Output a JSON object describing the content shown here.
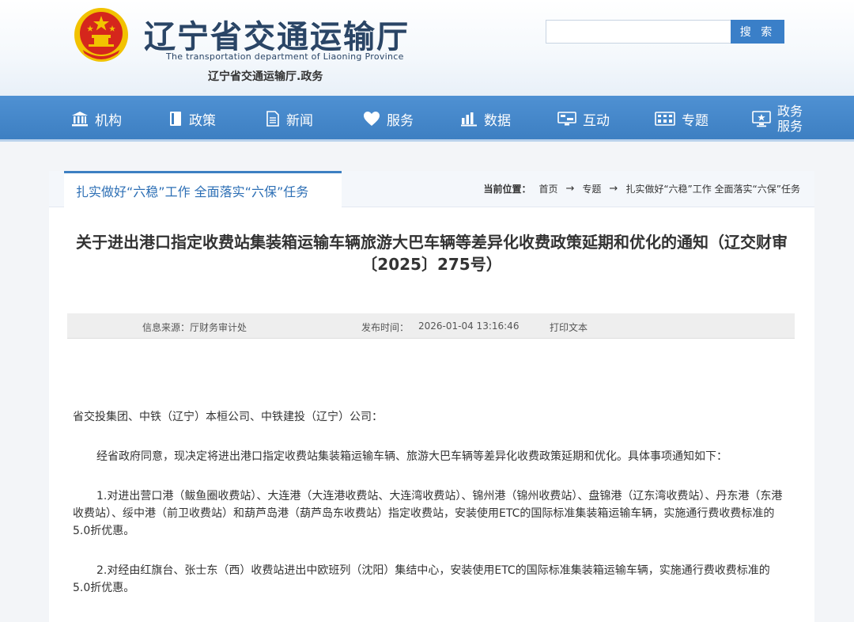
{
  "header": {
    "title": "辽宁省交通运输厅",
    "subtitle_en": "The transportation department of Liaoning Province",
    "subtitle_cn": "辽宁省交通运输厅.政务",
    "search_placeholder": "",
    "search_label": "搜 索",
    "emblem_icon": "national-emblem-icon"
  },
  "nav": {
    "items": [
      {
        "label": "机构",
        "icon": "institution-icon"
      },
      {
        "label": "政策",
        "icon": "document-icon"
      },
      {
        "label": "新闻",
        "icon": "news-icon"
      },
      {
        "label": "服务",
        "icon": "heart-icon"
      },
      {
        "label": "数据",
        "icon": "bar-chart-icon"
      },
      {
        "label": "互动",
        "icon": "chat-monitor-icon"
      },
      {
        "label": "专题",
        "icon": "film-icon"
      },
      {
        "label_line1": "政务",
        "label_line2": "服务",
        "icon": "monitor-icon"
      }
    ]
  },
  "crumbbar": {
    "tab_label": "扎实做好“六稳”工作 全面落实“六保”任务",
    "location_label": "当前位置：",
    "crumbs": [
      "首页",
      "专题",
      "扎实做好“六稳”工作 全面落实“六保”任务"
    ],
    "separator": "→"
  },
  "article": {
    "title": "关于进出港口指定收费站集装箱运输车辆旅游大巴车辆等差异化收费政策延期和优化的通知（辽交财审〔2025〕275号）",
    "meta": {
      "source": "信息来源：厅财务审计处",
      "publish_label": "发布时间：",
      "publish_time": "2026-01-04 13:16:46",
      "print_label": "打印文本"
    },
    "paragraphs": [
      "省交投集团、中铁（辽宁）本桓公司、中铁建投（辽宁）公司：",
      "经省政府同意，现决定将进出港口指定收费站集装箱运输车辆、旅游大巴车辆等差异化收费政策延期和优化。具体事项通知如下：",
      "1.对进出营口港（鲅鱼圈收费站）、大连港（大连港收费站、大连湾收费站）、锦州港（锦州收费站）、盘锦港（辽东湾收费站）、丹东港（东港收费站）、绥中港（前卫收费站）和葫芦岛港（葫芦岛东收费站）指定收费站，安装使用ETC的国际标准集装箱运输车辆，实施通行费收费标准的5.0折优惠。",
      "2.对经由红旗台、张士东（西）收费站进出中欧班列（沈阳）集结中心，安装使用ETC的国际标准集装箱运输车辆，实施通行费收费标准的5.0折优惠。"
    ]
  },
  "colors": {
    "nav_blue": "#3d7fc2",
    "title_blue": "#2a4566",
    "accent_red": "#d5261c",
    "gold": "#f2c200"
  }
}
